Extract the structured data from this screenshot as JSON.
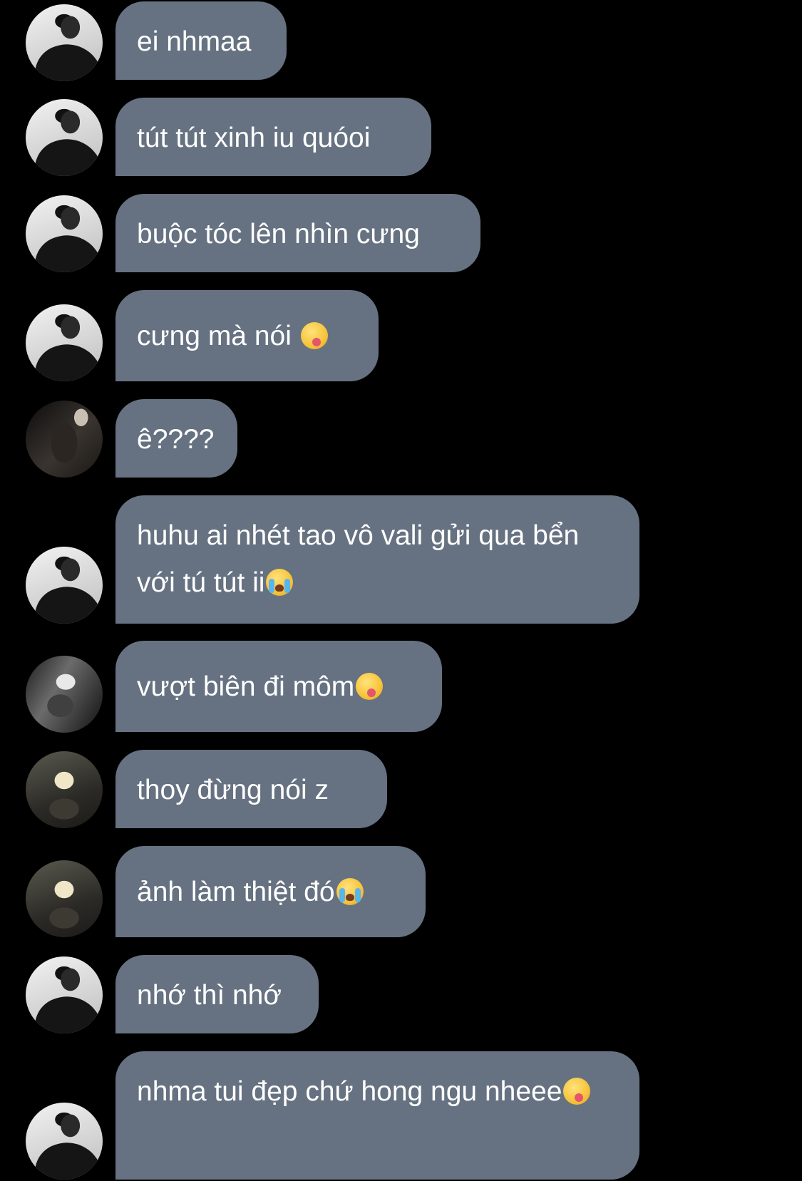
{
  "messages": [
    {
      "avatar": "avatar-user-1",
      "text": "ei nhmaa",
      "emoji": ""
    },
    {
      "avatar": "avatar-user-1",
      "text": "tút tút xinh iu quóoi",
      "emoji": ""
    },
    {
      "avatar": "avatar-user-1",
      "text": "buộc tóc lên nhìn cưng",
      "emoji": ""
    },
    {
      "avatar": "avatar-user-1",
      "text": "cưng mà nói ",
      "emoji": "face-savoring-food-emoji"
    },
    {
      "avatar": "avatar-user-2",
      "text": "ê????",
      "emoji": ""
    },
    {
      "avatar": "avatar-user-1",
      "text": "huhu ai nhét tao vô vali gửi qua bển với tú tút ii",
      "emoji": "loudly-crying-face-emoji"
    },
    {
      "avatar": "avatar-user-3",
      "text": "vượt biên đi môm",
      "emoji": "face-savoring-food-emoji"
    },
    {
      "avatar": "avatar-user-4",
      "text": "thoy đừng nói z",
      "emoji": ""
    },
    {
      "avatar": "avatar-user-4",
      "text": "ảnh làm thiệt đó",
      "emoji": "loudly-crying-face-emoji"
    },
    {
      "avatar": "avatar-user-1",
      "text": "nhớ thì nhớ",
      "emoji": ""
    },
    {
      "avatar": "avatar-user-1",
      "text": "nhma tui đẹp chứ hong ngu nheee",
      "emoji": "face-savoring-food-emoji"
    }
  ],
  "colors": {
    "background": "#000000",
    "bubble": "#667281",
    "text": "#ffffff"
  }
}
